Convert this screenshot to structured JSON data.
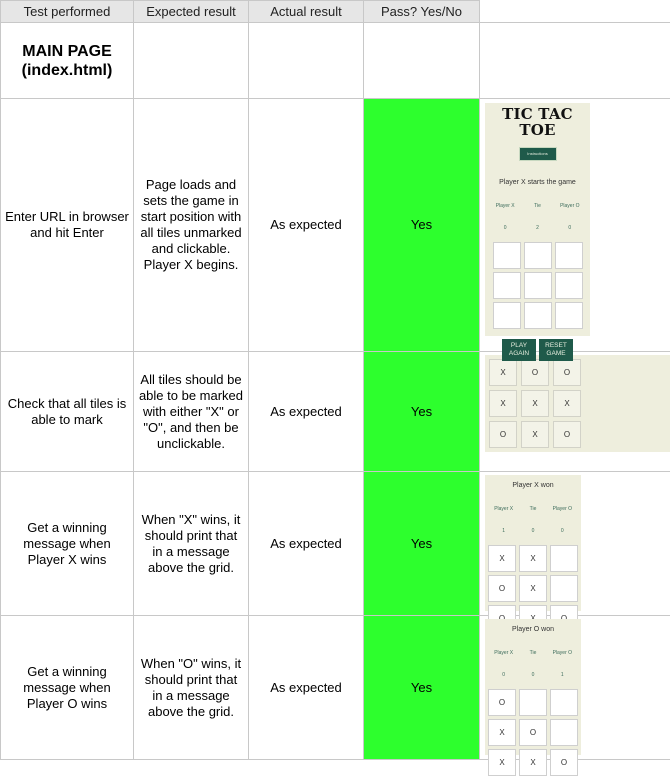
{
  "headers": [
    "Test performed",
    "Expected result",
    "Actual result",
    "Pass? Yes/No"
  ],
  "section_title": "MAIN PAGE\n(index.html)",
  "rows": [
    {
      "test": "Enter URL in browser and hit Enter",
      "expected": "Page loads and sets the game in start position with all tiles unmarked and clickable. Player X begins.",
      "actual": "As expected",
      "pass": "Yes"
    },
    {
      "test": "Check that all tiles is able to mark",
      "expected": "All tiles should be able to be marked with either \"X\" or \"O\", and then be unclickable.",
      "actual": "As expected",
      "pass": "Yes"
    },
    {
      "test": "Get a winning message when Player X wins",
      "expected": "When \"X\" wins, it should print that in a message above the grid.",
      "actual": "As expected",
      "pass": "Yes"
    },
    {
      "test": "Get a winning message when Player O wins",
      "expected": "When \"O\" wins, it should print that in a message above the grid.",
      "actual": "As expected",
      "pass": "Yes"
    }
  ],
  "shot1": {
    "title": "TIC TAC TOE",
    "instructions": "Instructions",
    "message": "Player X starts the game",
    "score_labels": [
      "Player X",
      "Tie",
      "Player O"
    ],
    "score_values": [
      "0",
      "2",
      "0"
    ],
    "cells": [
      "",
      "",
      "",
      "",
      "",
      "",
      "",
      "",
      ""
    ],
    "play_again": "PLAY AGAIN",
    "reset": "RESET GAME"
  },
  "shot2": {
    "cells": [
      "X",
      "O",
      "O",
      "X",
      "X",
      "X",
      "O",
      "X",
      "O"
    ]
  },
  "shot3": {
    "message": "Player X won",
    "score_labels": [
      "Player X",
      "Tie",
      "Player O"
    ],
    "score_values": [
      "1",
      "0",
      "0"
    ],
    "cells": [
      "X",
      "X",
      "",
      "O",
      "X",
      "",
      "O",
      "X",
      "O"
    ]
  },
  "shot4": {
    "message": "Player O won",
    "score_labels": [
      "Player X",
      "Tie",
      "Player O"
    ],
    "score_values": [
      "0",
      "0",
      "1"
    ],
    "cells": [
      "O",
      "",
      "",
      "X",
      "O",
      "",
      "X",
      "X",
      "O"
    ]
  },
  "colors": {
    "pass_fill": "#2dff2d",
    "game_bg": "#eeeedd",
    "button": "#1f5a4a"
  }
}
